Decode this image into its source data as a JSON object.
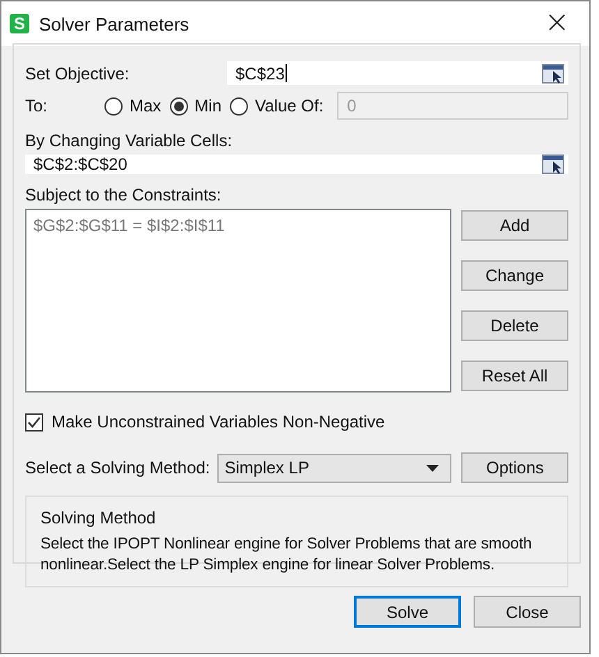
{
  "window": {
    "app_icon": "S",
    "title": "Solver Parameters",
    "close": "×"
  },
  "objective": {
    "label": "Set Objective:",
    "value": "$C$23"
  },
  "to": {
    "label": "To:",
    "options": [
      {
        "label": "Max",
        "selected": false
      },
      {
        "label": "Min",
        "selected": true
      },
      {
        "label": "Value Of:",
        "selected": false
      }
    ],
    "value_field": {
      "value": "0",
      "disabled": true
    }
  },
  "variables": {
    "label": "By Changing Variable Cells:",
    "value": "$C$2:$C$20"
  },
  "constraints": {
    "label": "Subject to the Constraints:",
    "items": [
      "$G$2:$G$11 = $I$2:$I$11"
    ],
    "buttons": [
      "Add",
      "Change",
      "Delete",
      "Reset All"
    ]
  },
  "non_negative": {
    "label": "Make Unconstrained Variables Non-Negative",
    "checked": true
  },
  "method": {
    "label": "Select a Solving Method:",
    "value": "Simplex LP",
    "button": "Options"
  },
  "description": {
    "title": "Solving Method",
    "text": "Select the IPOPT Nonlinear engine for Solver Problems that are smooth nonlinear.Select the LP Simplex engine for linear Solver Problems."
  },
  "footer": [
    {
      "label": "Solve",
      "default": true
    },
    {
      "label": "Close",
      "default": false
    }
  ]
}
